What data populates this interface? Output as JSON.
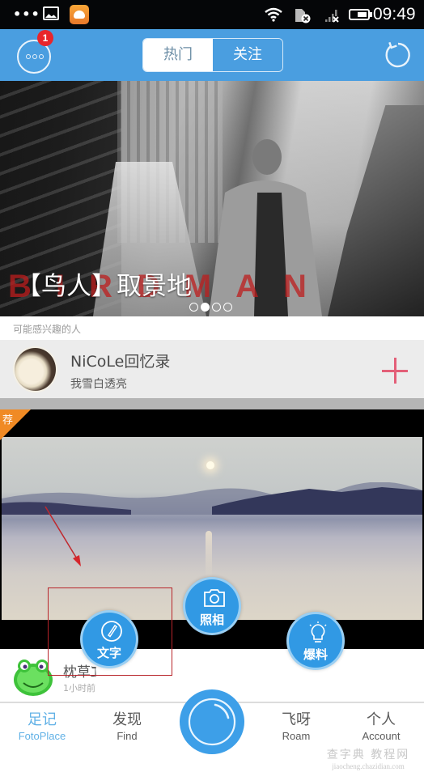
{
  "status_bar": {
    "overflow_indicator": "•••",
    "icons": [
      "gallery-icon",
      "game-app-icon",
      "wifi-icon",
      "sim-missing-icon",
      "signal-no-service-icon",
      "battery-icon"
    ],
    "time": "09:49"
  },
  "header": {
    "menu_icon": "more-options-icon",
    "notification_badge": "1",
    "tabs": [
      {
        "label": "热门",
        "active": true
      },
      {
        "label": "关注",
        "active": false
      }
    ],
    "refresh_icon": "refresh-icon",
    "accent_color": "#4a9ee0"
  },
  "banner": {
    "title": "【鸟人】取景地",
    "poster_letters": "BIRDMAN",
    "pages": 4,
    "current_page": 2
  },
  "suggestions": {
    "section_label": "可能感兴趣的人",
    "user": {
      "name": "NiCoLe回忆录",
      "subtitle": "我雪白透亮",
      "follow_icon": "plus-icon",
      "follow_color": "#e35f78"
    }
  },
  "feed": {
    "recommend_tag": "荐",
    "author": {
      "name": "枕草ℷ",
      "time": "1小时前"
    }
  },
  "quick_actions": [
    {
      "label": "文字",
      "icon": "pen-icon"
    },
    {
      "label": "照相",
      "icon": "camera-icon"
    },
    {
      "label": "爆料",
      "icon": "lightbulb-icon"
    }
  ],
  "bottom_nav": {
    "items": [
      {
        "cn": "足记",
        "en": "FotoPlace",
        "active": true
      },
      {
        "cn": "发现",
        "en": "Find",
        "active": false
      },
      {
        "cn": "飞呀",
        "en": "Roam",
        "active": false
      },
      {
        "cn": "个人",
        "en": "Account",
        "active": false
      }
    ],
    "center_button_icon": "shutter-icon"
  },
  "watermark": {
    "top": "查字典 教程网",
    "bottom": "jiaocheng.chazidian.com"
  }
}
